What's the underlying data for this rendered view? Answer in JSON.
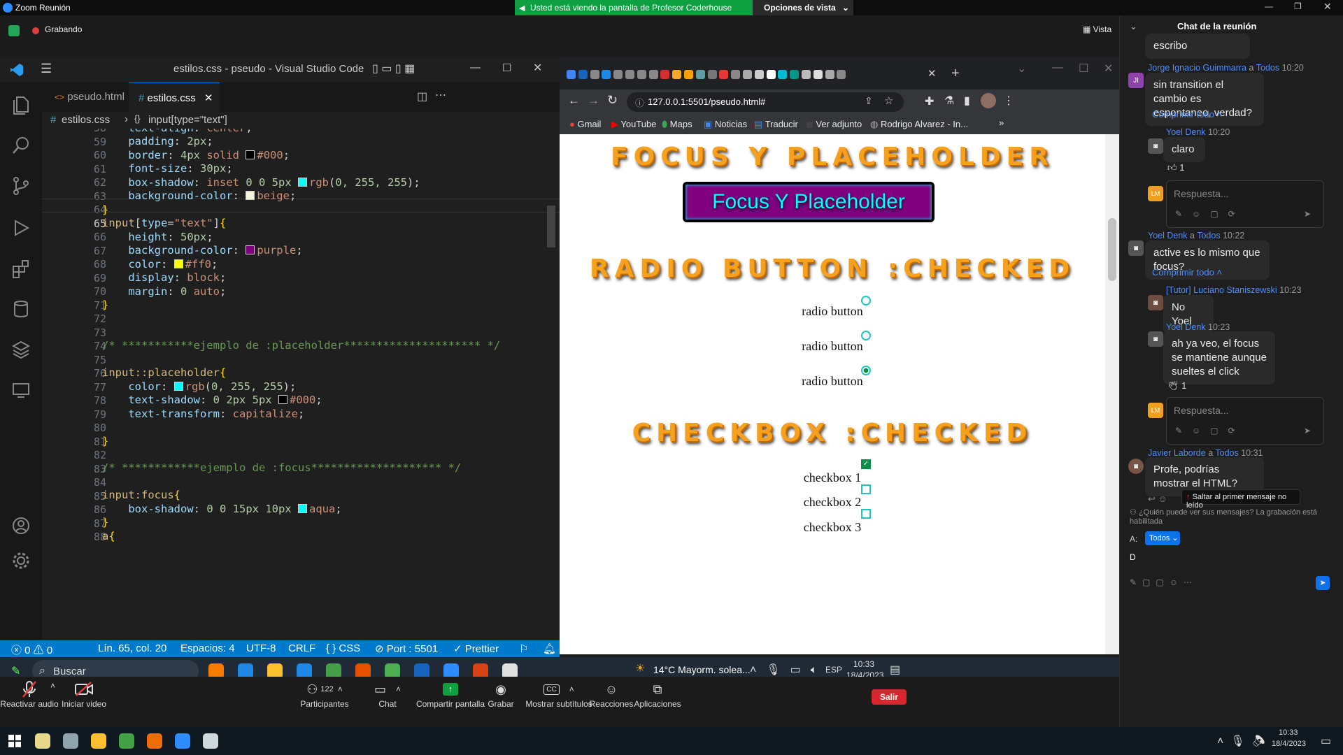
{
  "zoom": {
    "title": "Zoom Reunión",
    "banner": "Usted está viendo la pantalla de Profesor Coderhouse",
    "view_options": "Opciones de vista",
    "recording": "Grabando",
    "vista": "Vista",
    "bottom": {
      "audio": "Reactivar audio",
      "video": "Iniciar video",
      "participants": "Participantes",
      "participants_count": "122",
      "chat": "Chat",
      "share": "Compartir pantalla",
      "record": "Grabar",
      "captions": "Mostrar subtítulos",
      "reactions": "Reacciones",
      "apps": "Aplicaciones",
      "leave": "Salir"
    }
  },
  "vscode": {
    "title": "estilos.css - pseudo - Visual Studio Code",
    "tabs": [
      {
        "label": "pseudo.html",
        "icon": "<>"
      },
      {
        "label": "estilos.css",
        "icon": "#"
      }
    ],
    "breadcrumb": {
      "file": "estilos.css",
      "symbol": "input[type=\"text\"]"
    },
    "line_numbers": [
      "58",
      "59",
      "60",
      "61",
      "62",
      "63",
      "64",
      "65",
      "66",
      "67",
      "68",
      "69",
      "70",
      "71",
      "72",
      "73",
      "74",
      "75",
      "76",
      "77",
      "78",
      "79",
      "80",
      "81",
      "82",
      "83",
      "84",
      "85",
      "86",
      "87",
      "88"
    ],
    "status": {
      "errors": "0",
      "warnings": "0",
      "position": "Lín. 65, col. 20",
      "spaces": "Espacios: 4",
      "encoding": "UTF-8",
      "eol": "CRLF",
      "language": "CSS",
      "port": "Port : 5501",
      "prettier": "Prettier"
    }
  },
  "inner_taskbar": {
    "search": "Buscar",
    "weather": "14°C  Mayorm. solea...",
    "lang": "ESP",
    "time": "10:33",
    "date": "18/4/2023"
  },
  "browser": {
    "url": "127.0.0.1:5501/pseudo.html#",
    "bookmarks": [
      "Gmail",
      "YouTube",
      "Maps",
      "Noticias",
      "Traducir",
      "Ver adjunto",
      "Rodrigo Alvarez - In..."
    ],
    "page": {
      "h1": "FOCUS Y PLACEHOLDER",
      "input_placeholder": "Focus Y Placeholder",
      "h2": "RADIO BUTTON :CHECKED",
      "radio_label": "radio button",
      "h3": "CHECKBOX :CHECKED",
      "checkboxes": [
        "checkbox 1",
        "checkbox 2",
        "checkbox 3"
      ]
    }
  },
  "chat": {
    "title": "Chat de la reunión",
    "first_bubble": "escribo",
    "m1": {
      "name": "Jorge Ignacio Guimmarra",
      "to": "a",
      "dest": "Todos",
      "time": "10:20",
      "text": "sin transition el cambio es espontaneo, verdad?",
      "initials": "JI"
    },
    "collapse": "Comprimir todo",
    "r1": {
      "name": "Yoel Denk",
      "time": "10:20",
      "text": "claro",
      "reaction": "1"
    },
    "reply_ph": "Respuesta...",
    "reply_initials": "LM",
    "m2": {
      "name": "Yoel Denk",
      "to": "a",
      "dest": "Todos",
      "time": "10:22",
      "text": "active es lo mismo que focus?"
    },
    "r2": {
      "name": "[Tutor] Luciano Staniszewski",
      "time": "10:23",
      "text": "No Yoel"
    },
    "r3": {
      "name": "Yoel Denk",
      "time": "10:23",
      "text": "ah ya veo, el focus se mantiene aunque sueltes el click",
      "reaction": "1"
    },
    "m3": {
      "name": "Javier Laborde",
      "to": "a",
      "dest": "Todos",
      "time": "10:31",
      "text": "Profe, podrías mostrar el HTML?"
    },
    "jump": "Saltar al primer mensaje no leído",
    "privacy": "¿Quién puede ver sus mensajes? La grabación está habilitada",
    "to_label": "A:",
    "to_value": "Todos",
    "draft": "D"
  },
  "os": {
    "time": "10:33",
    "date": "18/4/2023"
  },
  "colors": {
    "vscode_status": "#007acc",
    "zoom_green": "#0e9f40",
    "leave": "#d7262d",
    "heading": "#f5a11f",
    "input_bg": "#800080",
    "input_text": "#ffff00"
  }
}
